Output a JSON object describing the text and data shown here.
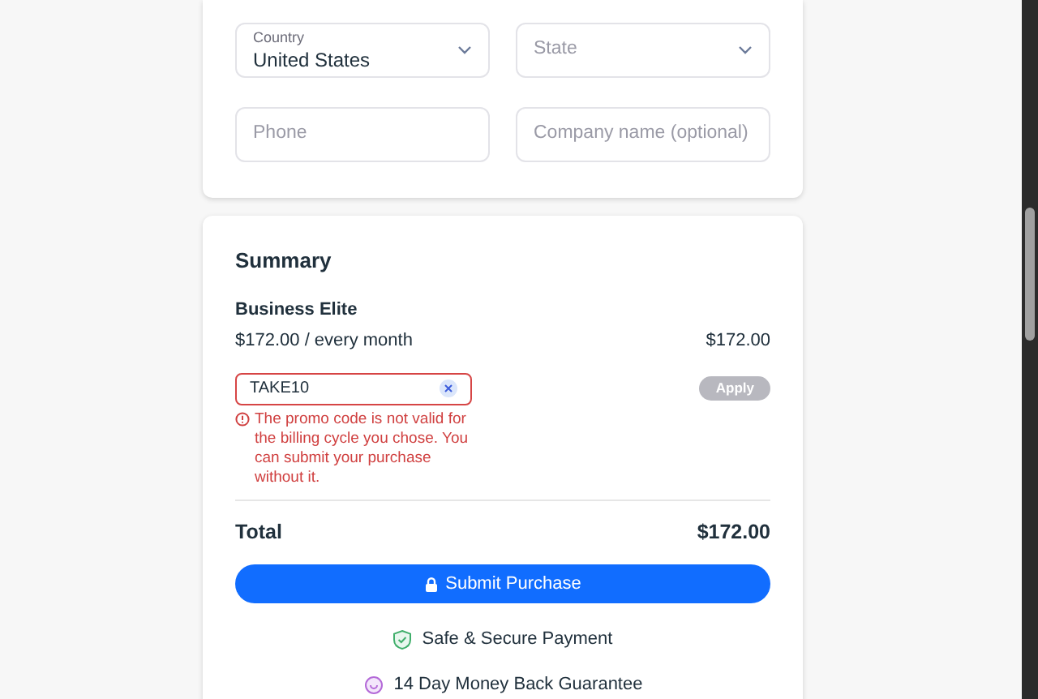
{
  "address_fields": [
    {
      "kind": "select",
      "label": "Country",
      "value": "United States"
    },
    {
      "kind": "select",
      "placeholder": "State"
    },
    {
      "kind": "text",
      "placeholder": "Phone"
    },
    {
      "kind": "text",
      "placeholder": "Company name (optional)"
    }
  ],
  "summary": {
    "title": "Summary",
    "plan_name": "Business Elite",
    "plan_price": "$172.00 / every month",
    "plan_amount": "$172.00",
    "promo": {
      "value": "TAKE10",
      "invalid": true,
      "apply_label": "Apply",
      "apply_disabled": true,
      "error": "The promo code is not valid for the billing cycle you chose. You can submit your purchase without it."
    },
    "total_label": "Total",
    "total_amount": "$172.00",
    "submit_label": "Submit Purchase",
    "badges": [
      {
        "kind": "secure",
        "text": "Safe & Secure Payment"
      },
      {
        "kind": "guarantee",
        "text": "14 Day Money Back Guarantee"
      }
    ]
  }
}
